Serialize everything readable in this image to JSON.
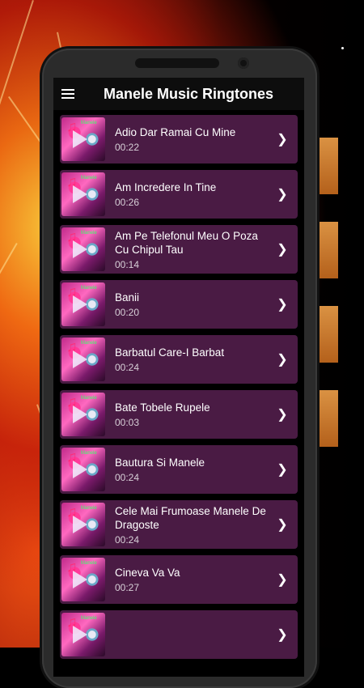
{
  "app": {
    "title": "Manele Music Ringtones"
  },
  "icons": {
    "menu": "hamburger-menu-icon",
    "row_chevron": "chevron-right-icon",
    "thumb": "music-note-play-icon"
  },
  "colors": {
    "row_background": "#4a1b44",
    "appbar": "#0d0d0d",
    "accent": "#ff69c0"
  },
  "ringtones": [
    {
      "name": "Adio Dar Ramai Cu Mine",
      "duration": "00:22"
    },
    {
      "name": "Am Incredere In Tine",
      "duration": "00:26"
    },
    {
      "name": "Am Pe Telefonul Meu O Poza Cu Chipul Tau",
      "duration": "00:14"
    },
    {
      "name": "Banii",
      "duration": "00:20"
    },
    {
      "name": "Barbatul Care-I Barbat",
      "duration": "00:24"
    },
    {
      "name": "Bate Tobele Rupele",
      "duration": "00:03"
    },
    {
      "name": "Bautura Si Manele",
      "duration": "00:24"
    },
    {
      "name": "Cele Mai Frumoase Manele De Dragoste",
      "duration": "00:24"
    },
    {
      "name": "Cineva Va Va",
      "duration": "00:27"
    },
    {
      "name": "",
      "duration": ""
    }
  ]
}
